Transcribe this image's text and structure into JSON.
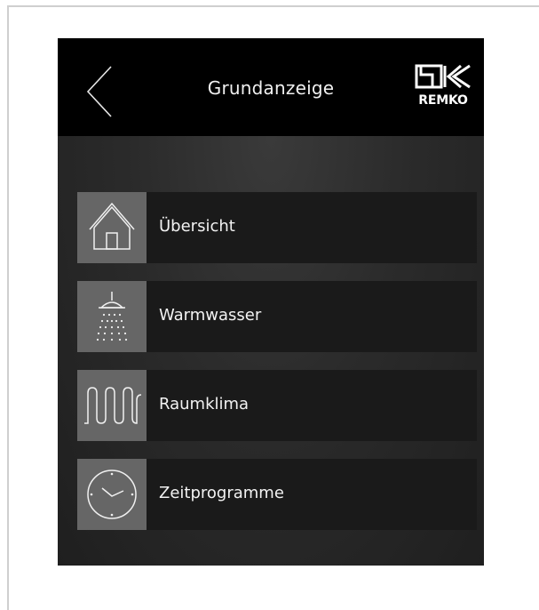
{
  "header": {
    "title": "Grundanzeige",
    "back_icon": "chevron-left-icon",
    "logo_text": "REMKO"
  },
  "menu": {
    "items": [
      {
        "label": "Übersicht",
        "icon": "house-icon"
      },
      {
        "label": "Warmwasser",
        "icon": "shower-icon"
      },
      {
        "label": "Raumklima",
        "icon": "heating-coil-icon"
      },
      {
        "label": "Zeitprogramme",
        "icon": "clock-icon"
      }
    ]
  },
  "colors": {
    "header_bg": "#000000",
    "icon_box_bg": "#666666",
    "item_bg": "#1a1a1a",
    "text": "#f2f2f2"
  }
}
